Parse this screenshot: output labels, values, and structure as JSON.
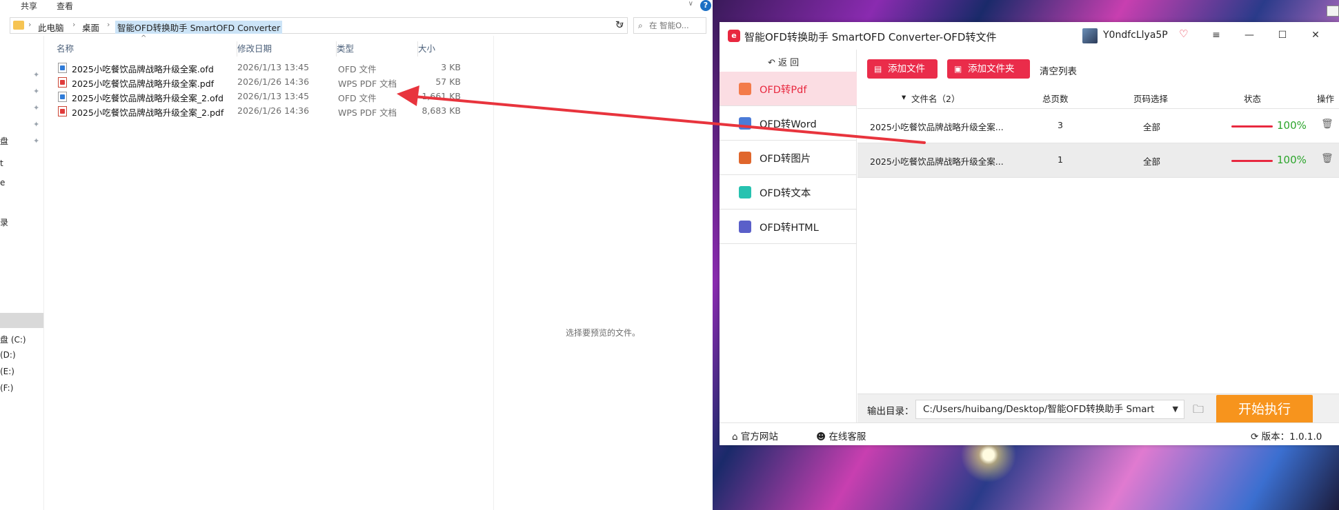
{
  "explorer": {
    "ribbon": {
      "share": "共享",
      "view": "查看",
      "help": "?"
    },
    "address": {
      "crumbs": [
        "此电脑",
        "桌面",
        "智能OFD转换助手 SmartOFD Converter"
      ]
    },
    "search_placeholder": "在 智能O...",
    "nav_fragments": [
      "盘",
      "t",
      "e",
      "录",
      "盘 (C:)",
      "(D:)",
      "(E:)",
      "(F:)"
    ],
    "columns": {
      "name": "名称",
      "date": "修改日期",
      "type": "类型",
      "size": "大小"
    },
    "files": [
      {
        "name": "2025小吃餐饮品牌战略升级全案.ofd",
        "date": "2026/1/13 13:45",
        "type": "OFD 文件",
        "size": "3 KB",
        "icon": "ofd-file-icon"
      },
      {
        "name": "2025小吃餐饮品牌战略升级全案.pdf",
        "date": "2026/1/26 14:36",
        "type": "WPS PDF 文档",
        "size": "57 KB",
        "icon": "pdf-file-icon"
      },
      {
        "name": "2025小吃餐饮品牌战略升级全案_2.ofd",
        "date": "2026/1/13 13:45",
        "type": "OFD 文件",
        "size": "1,661 KB",
        "icon": "ofd-file-icon"
      },
      {
        "name": "2025小吃餐饮品牌战略升级全案_2.pdf",
        "date": "2026/1/26 14:36",
        "type": "WPS PDF 文档",
        "size": "8,683 KB",
        "icon": "pdf-file-icon"
      }
    ],
    "preview_text": "选择要预览的文件。"
  },
  "app": {
    "title": "智能OFD转换助手 SmartOFD Converter-OFD转文件",
    "username": "Y0ndfcLlya5P",
    "back": {
      "label": "返  回"
    },
    "menu": [
      {
        "label": "OFD转Pdf",
        "icon_color": "#f37b4a",
        "active": true
      },
      {
        "label": "OFD转Word",
        "icon_color": "#4b7bd8",
        "active": false
      },
      {
        "label": "OFD转图片",
        "icon_color": "#e0662c",
        "active": false
      },
      {
        "label": "OFD转文本",
        "icon_color": "#27c2b0",
        "active": false
      },
      {
        "label": "OFD转HTML",
        "icon_color": "#5a5fc9",
        "active": false
      }
    ],
    "toolbar": {
      "add_file": "添加文件",
      "add_folder": "添加文件夹",
      "clear": "清空列表"
    },
    "table": {
      "headers": {
        "filename": "文件名（2）",
        "pages": "总页数",
        "page_select": "页码选择",
        "status": "状态",
        "action": "操作"
      },
      "rows": [
        {
          "filename": "2025小吃餐饮品牌战略升级全案...",
          "pages": "3",
          "page_select": "全部",
          "progress": "100%"
        },
        {
          "filename": "2025小吃餐饮品牌战略升级全案...",
          "pages": "1",
          "page_select": "全部",
          "progress": "100%"
        }
      ]
    },
    "output": {
      "label": "输出目录：",
      "path": "C:/Users/huibang/Desktop/智能OFD转换助手 Smart"
    },
    "start_button": "开始执行",
    "statusbar": {
      "website": "官方网站",
      "support": "在线客服",
      "version": "版本：1.0.1.0"
    }
  },
  "colors": {
    "accent": "#e8283f",
    "start": "#f7941d",
    "progress_text": "#2ca52c",
    "annotation_arrow": "#e8343d"
  }
}
